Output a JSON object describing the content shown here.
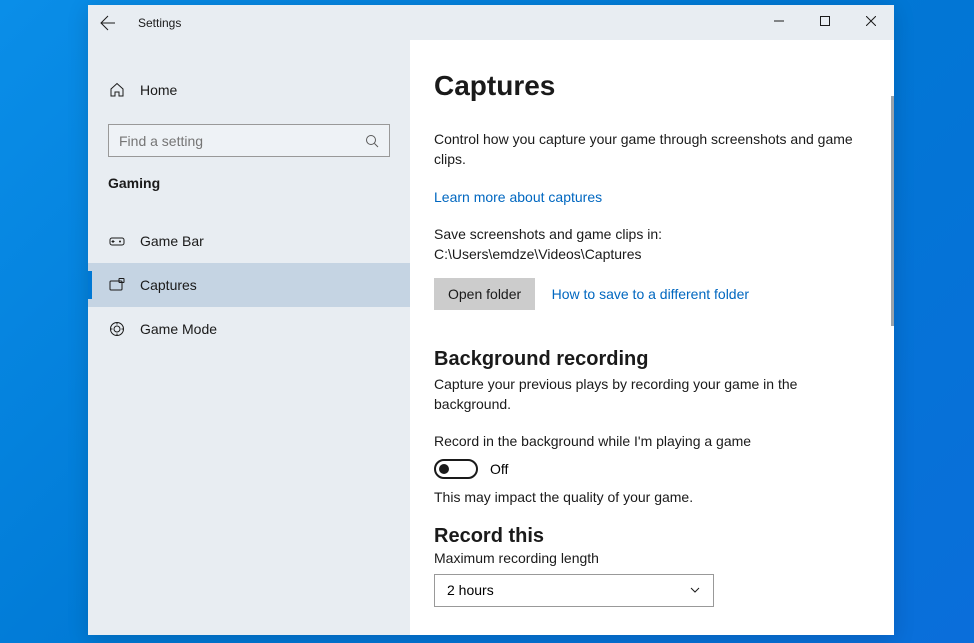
{
  "window": {
    "title": "Settings"
  },
  "sidebar": {
    "home_label": "Home",
    "search_placeholder": "Find a setting",
    "category_label": "Gaming",
    "items": [
      {
        "label": "Game Bar"
      },
      {
        "label": "Captures"
      },
      {
        "label": "Game Mode"
      }
    ]
  },
  "main": {
    "title": "Captures",
    "intro": "Control how you capture your game through screenshots and game clips.",
    "learn_more_link": "Learn more about captures",
    "save_location_text": "Save screenshots and game clips in: C:\\Users\\emdze\\Videos\\Captures",
    "open_folder_btn": "Open folder",
    "diff_folder_link": "How to save to a different folder",
    "bg_recording": {
      "heading": "Background recording",
      "desc": "Capture your previous plays by recording your game in the background.",
      "toggle_label": "Record in the background while I'm playing a game",
      "toggle_state": "Off",
      "note": "This may impact the quality of your game."
    },
    "record_this": {
      "heading": "Record this",
      "max_label": "Maximum recording length",
      "selected": "2 hours"
    }
  }
}
